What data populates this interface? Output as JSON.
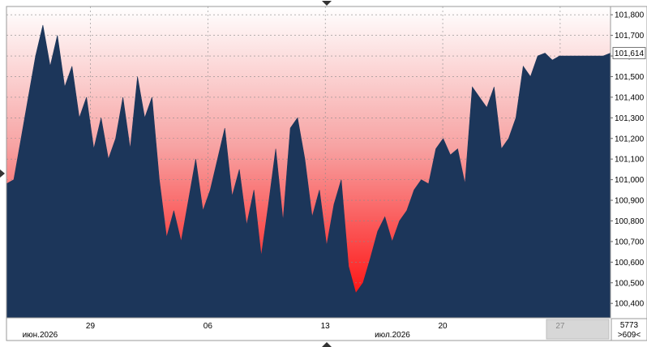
{
  "chart_data": {
    "type": "area",
    "title": "",
    "xlabel": "",
    "ylabel": "",
    "ylim": [
      100.33,
      101.84
    ],
    "yticks": [
      "101,800",
      "101,700",
      "101,600",
      "101,500",
      "101,400",
      "101,300",
      "101,200",
      "101,100",
      "101,000",
      "100,900",
      "100,800",
      "100,700",
      "100,600",
      "100,500",
      "100,400"
    ],
    "ytick_values": [
      101.8,
      101.7,
      101.6,
      101.5,
      101.4,
      101.3,
      101.2,
      101.1,
      101.0,
      100.9,
      100.8,
      100.7,
      100.6,
      100.5,
      100.4
    ],
    "xticks": [
      "29",
      "06",
      "13",
      "20",
      "27"
    ],
    "xtick_dates": [
      "2026-06-29",
      "2026-07-06",
      "2026-07-13",
      "2026-07-20",
      "2026-07-27"
    ],
    "month_labels": [
      "июн.2026",
      "июл.2026"
    ],
    "month_label_dates": [
      "2026-06-26",
      "2026-07-17"
    ],
    "last_value_label": "101,614",
    "last_value": 101.614,
    "counter_top": "5773",
    "counter_bottom": ">609<",
    "grid": true,
    "colors": {
      "fill": "#1c365a",
      "gradient_top": "#ffffff",
      "gradient_bottom": "#ff0000",
      "grid": "#8a8a8a"
    },
    "series": [
      {
        "x": [
          "2026-06-24",
          "2026-06-24",
          "2026-06-25",
          "2026-06-25",
          "2026-06-25",
          "2026-06-25",
          "2026-06-26",
          "2026-06-26",
          "2026-06-26",
          "2026-06-26",
          "2026-06-27",
          "2026-06-27",
          "2026-06-28",
          "2026-06-28",
          "2026-06-28",
          "2026-06-29",
          "2026-06-29",
          "2026-06-30",
          "2026-06-30",
          "2026-06-30",
          "2026-07-01",
          "2026-07-01",
          "2026-07-01",
          "2026-07-02",
          "2026-07-02",
          "2026-07-03",
          "2026-07-03",
          "2026-07-03",
          "2026-07-04",
          "2026-07-04",
          "2026-07-05",
          "2026-07-05",
          "2026-07-05",
          "2026-07-06",
          "2026-07-06",
          "2026-07-07",
          "2026-07-07",
          "2026-07-07",
          "2026-07-08",
          "2026-07-08",
          "2026-07-09",
          "2026-07-09",
          "2026-07-10",
          "2026-07-10",
          "2026-07-11",
          "2026-07-11",
          "2026-07-11",
          "2026-07-12",
          "2026-07-12",
          "2026-07-13",
          "2026-07-13",
          "2026-07-14",
          "2026-07-14",
          "2026-07-15",
          "2026-07-15",
          "2026-07-15",
          "2026-07-16",
          "2026-07-16",
          "2026-07-17",
          "2026-07-17",
          "2026-07-17",
          "2026-07-18",
          "2026-07-18",
          "2026-07-19",
          "2026-07-19",
          "2026-07-20",
          "2026-07-20",
          "2026-07-21",
          "2026-07-21",
          "2026-07-21",
          "2026-07-22",
          "2026-07-22",
          "2026-07-23",
          "2026-07-23",
          "2026-07-24",
          "2026-07-24",
          "2026-07-24",
          "2026-07-25",
          "2026-07-25",
          "2026-07-26",
          "2026-07-26",
          "2026-07-27",
          "2026-07-27",
          "2026-07-27"
        ],
        "y": [
          100.98,
          101.0,
          101.2,
          101.4,
          101.6,
          101.75,
          101.55,
          101.7,
          101.45,
          101.55,
          101.3,
          101.4,
          101.15,
          101.3,
          101.1,
          101.2,
          101.4,
          101.15,
          101.5,
          101.3,
          101.4,
          101.0,
          100.72,
          100.85,
          100.7,
          100.9,
          101.1,
          100.85,
          100.95,
          101.1,
          101.25,
          100.92,
          101.05,
          100.78,
          100.95,
          100.63,
          100.88,
          101.15,
          100.8,
          101.25,
          101.3,
          101.1,
          100.82,
          100.95,
          100.68,
          100.88,
          101.0,
          100.58,
          100.45,
          100.5,
          100.62,
          100.75,
          100.82,
          100.7,
          100.8,
          100.85,
          100.95,
          101.0,
          100.98,
          101.15,
          101.2,
          101.12,
          101.15,
          100.98,
          101.45,
          101.4,
          101.35,
          101.45,
          101.15,
          101.2,
          101.3,
          101.55,
          101.5,
          101.6,
          101.614,
          101.58,
          101.6,
          101.6,
          101.6,
          101.6,
          101.6,
          101.6,
          101.6,
          101.614
        ]
      }
    ]
  }
}
